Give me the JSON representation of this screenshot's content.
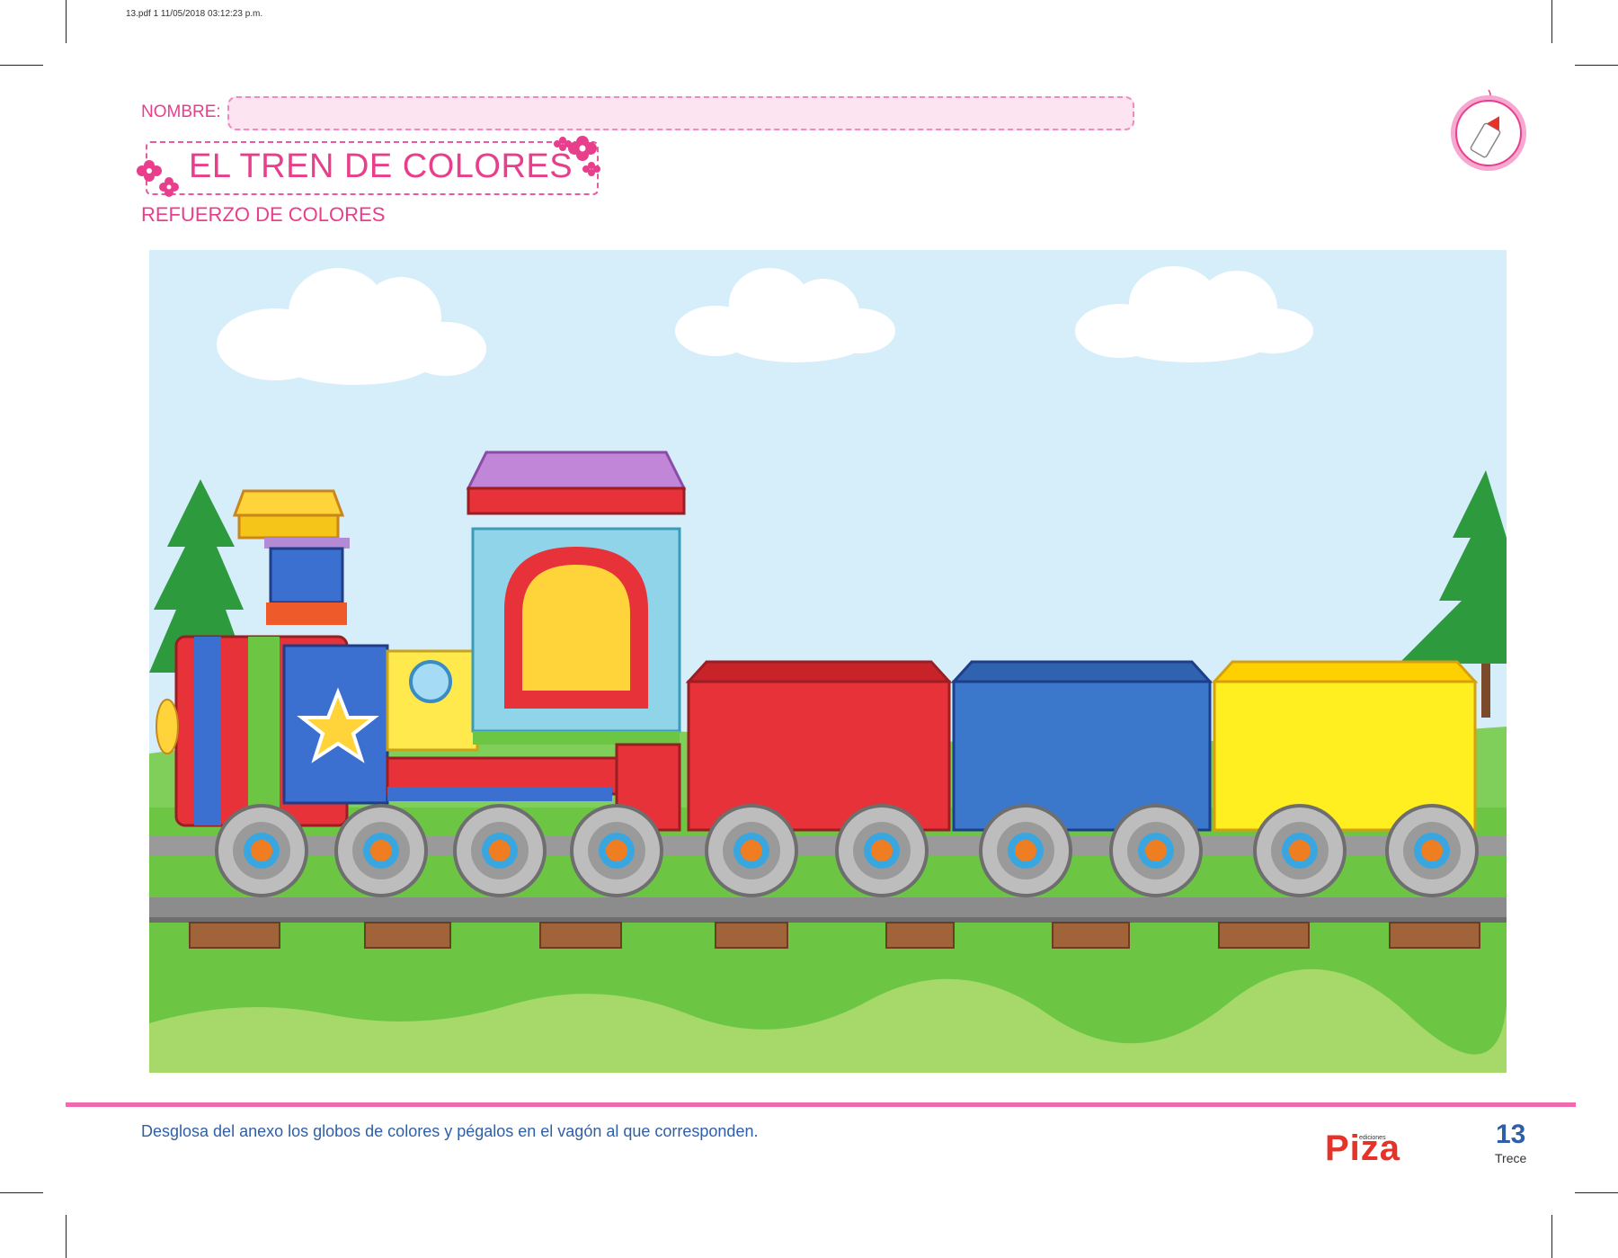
{
  "print_info": "13.pdf   1   11/05/2018   03:12:23 p.m.",
  "nombre_label": "NOMBRE:",
  "title": "EL TREN DE COLORES",
  "subtitle": "REFUERZO DE COLORES",
  "instruction": "Desglosa del anexo los globos de colores y pégalos en el vagón al que corresponden.",
  "brand": {
    "name": "Piza",
    "small": "ediciones"
  },
  "page": {
    "number": "13",
    "word": "Trece"
  },
  "colors": {
    "pink": "#e83e8c",
    "blue_text": "#2e5fa7",
    "sky": "#d6eefa",
    "grass": "#6cc644"
  },
  "icons": [
    "glue-bottle-icon",
    "flower-icon"
  ]
}
